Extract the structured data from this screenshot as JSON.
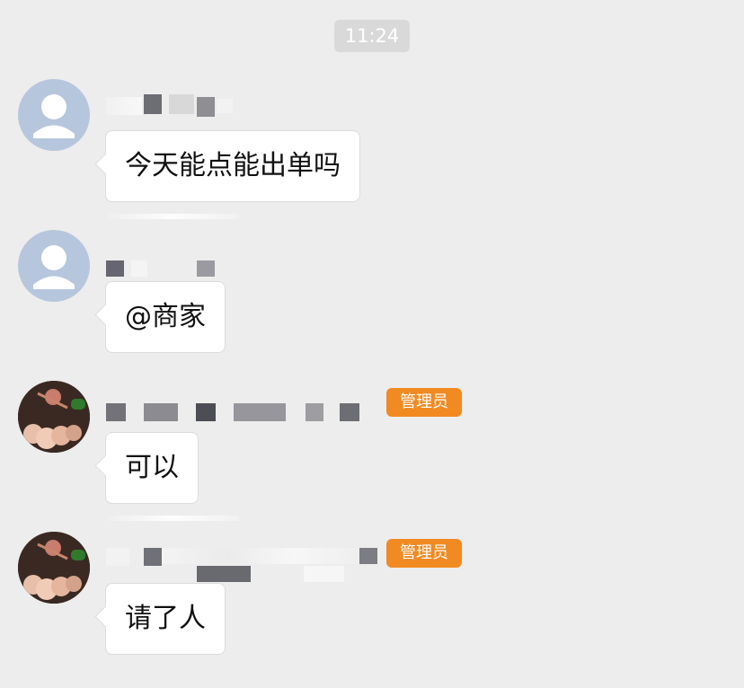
{
  "chat": {
    "timestamp": "11:24",
    "messages": [
      {
        "text": "今天能点能出单吗",
        "badge": ""
      },
      {
        "text": "@商家",
        "badge": ""
      },
      {
        "text": "可以",
        "badge": "管理员"
      },
      {
        "text": "请了人",
        "badge": "管理员"
      }
    ]
  },
  "colors": {
    "background": "#ededed",
    "bubble": "#ffffff",
    "admin_badge": "#f28a22",
    "timestamp_pill": "#d9d9d9",
    "default_avatar": "#b6c6dd"
  },
  "icons": {
    "default_avatar": "default-user-avatar-icon",
    "photo_avatar": "food-photo-avatar"
  }
}
